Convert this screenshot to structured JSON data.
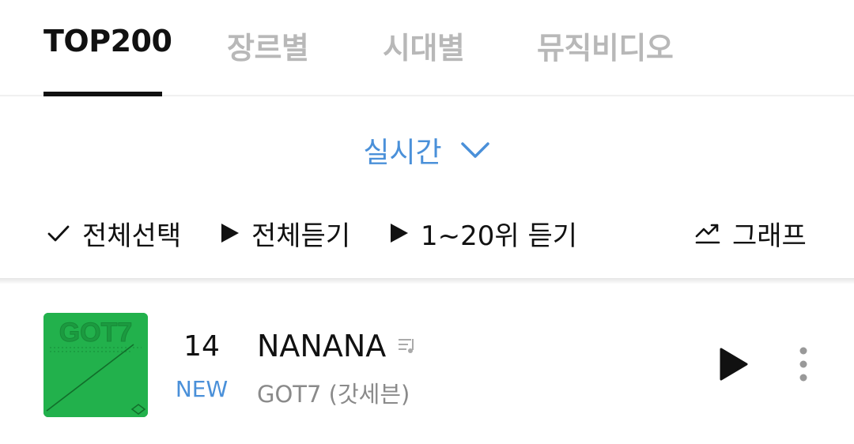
{
  "tabs": [
    {
      "label": "TOP200",
      "active": true
    },
    {
      "label": "장르별",
      "active": false
    },
    {
      "label": "시대별",
      "active": false
    },
    {
      "label": "뮤직비디오",
      "active": false
    }
  ],
  "period": {
    "label": "실시간",
    "icon": "chevron-down-icon"
  },
  "actions": {
    "select_all": "전체선택",
    "play_all": "전체듣기",
    "play_top20": "1~20위 듣기",
    "graph": "그래프"
  },
  "song": {
    "rank": "14",
    "rank_change": "NEW",
    "title": "NANANA",
    "artist": "GOT7 (갓세븐)",
    "album_art_text": "GOT7"
  },
  "colors": {
    "accent_blue": "#4a90d9",
    "album_green": "#22b14c",
    "inactive_tab": "#b8b8b8"
  }
}
